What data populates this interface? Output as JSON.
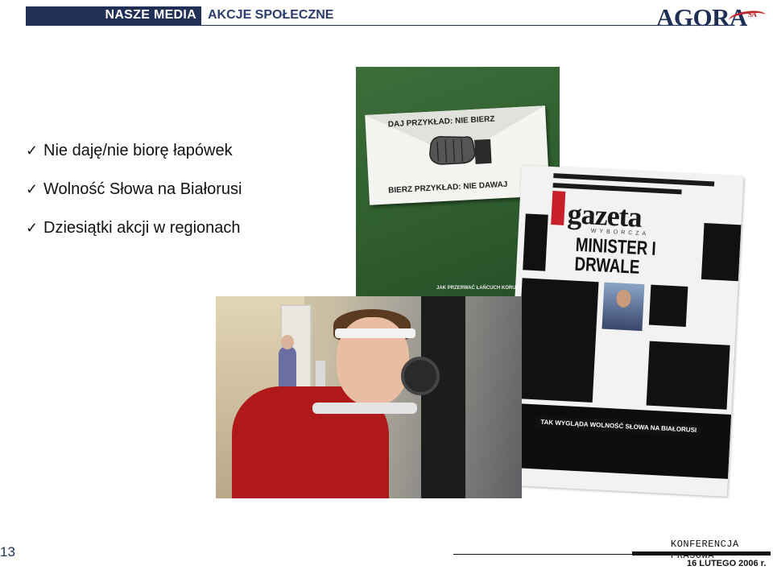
{
  "header": {
    "section": "NASZE MEDIA",
    "subsection": "AKCJE SPOŁECZNE",
    "logo_text": "AGORA",
    "logo_suffix": "SA",
    "colors": {
      "navy": "#1f2f55",
      "red": "#c0272d"
    }
  },
  "bullets": [
    {
      "icon": "checkmark-icon",
      "text": "Nie daję/nie biorę łapówek"
    },
    {
      "icon": "checkmark-icon",
      "text": "Wolność Słowa na Białorusi"
    },
    {
      "icon": "checkmark-icon",
      "text": "Dziesiątki akcji w regionach"
    }
  ],
  "images": {
    "poster": {
      "top_text": "DAJ PRZYKŁAD: NIE BIERZ",
      "bottom_text": "BIERZ PRZYKŁAD: NIE DAWAJ",
      "foot_text": "JAK PRZERWAĆ ŁAŃCUCH KORUPCJI"
    },
    "newspaper": {
      "masthead": "gazeta",
      "masthead_sub": "WYBORCZA",
      "headline": "MINISTER I DRWALE",
      "caption": "TAK WYGLĄDA WOLNOŚĆ SŁOWA NA BIAŁORUSI"
    }
  },
  "footer": {
    "page_number": "13",
    "conference": "KONFERENCJA PRASOWA",
    "date": "16 LUTEGO 2006 r."
  }
}
